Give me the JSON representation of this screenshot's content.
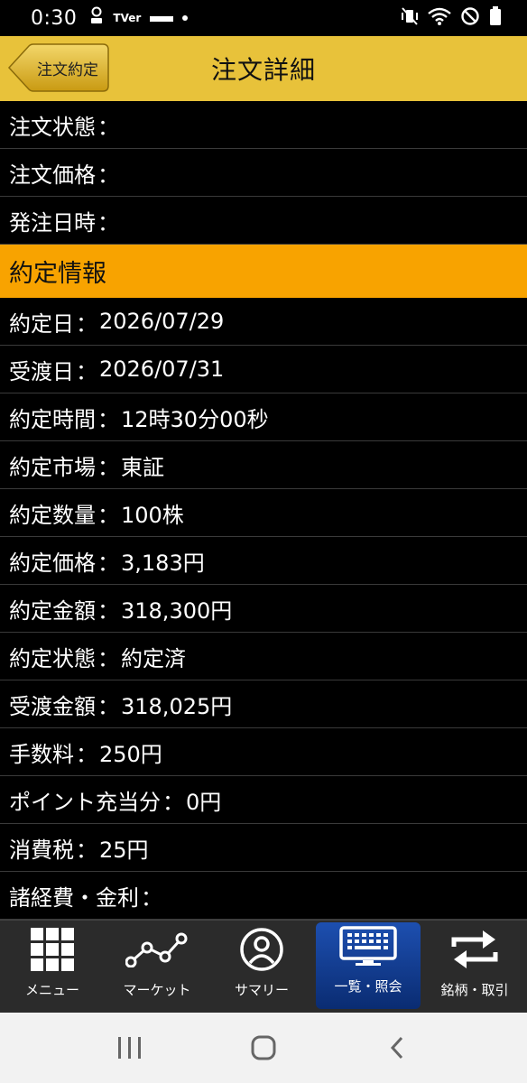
{
  "status_bar": {
    "time": "0:30",
    "left_icons": [
      "badge-icon",
      "tver-icon",
      "app-icon",
      "dot-icon"
    ],
    "tver_text": "TVer",
    "right_icons": [
      "mute-vibrate-icon",
      "wifi-icon",
      "do-not-disturb-icon",
      "battery-icon"
    ]
  },
  "header": {
    "back_label": "注文約定",
    "title": "注文詳細",
    "color": "#e8c23a"
  },
  "order_rows": [
    {
      "label": "注文状態",
      "value": ""
    },
    {
      "label": "注文価格",
      "value": ""
    },
    {
      "label": "発注日時",
      "value": ""
    }
  ],
  "execution_section": {
    "title": "約定情報",
    "color": "#f8a300",
    "rows": [
      {
        "label": "約定日",
        "value": "2026/07/29"
      },
      {
        "label": "受渡日",
        "value": "2026/07/31"
      },
      {
        "label": "約定時間",
        "value": "12時30分00秒"
      },
      {
        "label": "約定市場",
        "value": "東証"
      },
      {
        "label": "約定数量",
        "value": "100株"
      },
      {
        "label": "約定価格",
        "value": "3,183円"
      },
      {
        "label": "約定金額",
        "value": "318,300円"
      },
      {
        "label": "約定状態",
        "value": "約定済"
      },
      {
        "label": "受渡金額",
        "value": "318,025円"
      },
      {
        "label": "手数料",
        "value": "250円"
      },
      {
        "label": "ポイント充当分",
        "value": "0円"
      },
      {
        "label": "消費税",
        "value": "25円"
      },
      {
        "label": "諸経費・金利",
        "value": ""
      }
    ]
  },
  "separator": "：",
  "bottom_nav": {
    "items": [
      {
        "label": "メニュー",
        "icon": "grid-icon",
        "active": false
      },
      {
        "label": "マーケット",
        "icon": "chart-line-icon",
        "active": false
      },
      {
        "label": "サマリー",
        "icon": "person-icon",
        "active": false
      },
      {
        "label": "一覧・照会",
        "icon": "keyboard-monitor-icon",
        "active": true
      },
      {
        "label": "銘柄・取引",
        "icon": "swap-arrows-icon",
        "active": false
      }
    ],
    "active_color": "#1d4fb0"
  },
  "system_nav": [
    "recents-icon",
    "home-icon",
    "back-icon"
  ]
}
